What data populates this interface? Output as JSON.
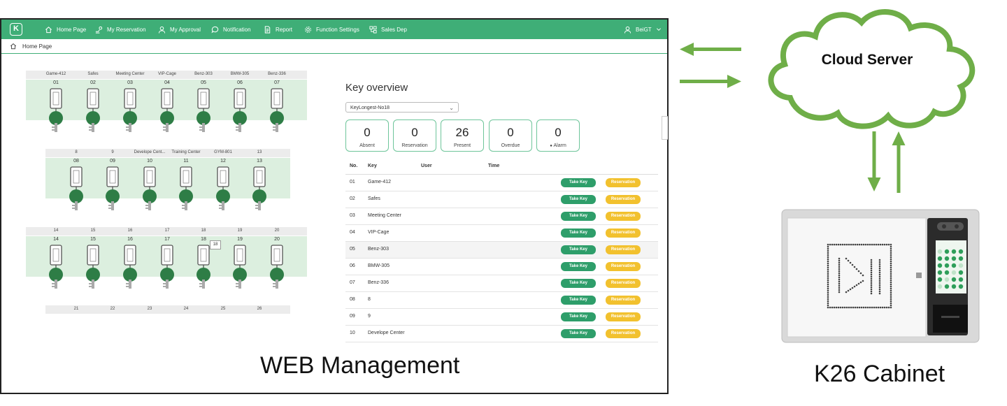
{
  "nav": {
    "items": [
      {
        "label": "Home Page",
        "icon": "home-icon"
      },
      {
        "label": "My Reservation",
        "icon": "key-hand-icon"
      },
      {
        "label": "My Approval",
        "icon": "user-icon"
      },
      {
        "label": "Notification",
        "icon": "chat-icon"
      },
      {
        "label": "Report",
        "icon": "document-icon"
      },
      {
        "label": "Function Settings",
        "icon": "gear-icon"
      },
      {
        "label": "Sales Dep",
        "icon": "org-icon"
      }
    ],
    "user": "BeiGT"
  },
  "breadcrumb": "Home Page",
  "cabinet": {
    "rows": [
      {
        "labels": [
          "Game-412",
          "Safes",
          "Meeting Center",
          "VIP-Cage",
          "Benz-303",
          "BMW-305",
          "Benz-336"
        ],
        "numbers": [
          "01",
          "02",
          "03",
          "04",
          "05",
          "06",
          "07"
        ]
      },
      {
        "labels": [
          "8",
          "9",
          "Develope Cent...",
          "Training Center",
          "GYM-801",
          "13"
        ],
        "numbers": [
          "08",
          "09",
          "10",
          "11",
          "12",
          "13"
        ]
      },
      {
        "labels": [
          "14",
          "15",
          "16",
          "17",
          "18",
          "19",
          "20"
        ],
        "numbers": [
          "14",
          "15",
          "16",
          "17",
          "18",
          "19",
          "20"
        ]
      },
      {
        "labels": [
          "21",
          "22",
          "23",
          "24",
          "25",
          "26"
        ],
        "numbers": []
      }
    ],
    "tooltip": "18"
  },
  "overview": {
    "title": "Key overview",
    "cabinet_select": "KeyLongest-No18",
    "stats": [
      {
        "value": "0",
        "label": "Absent"
      },
      {
        "value": "0",
        "label": "Reservation"
      },
      {
        "value": "26",
        "label": "Present"
      },
      {
        "value": "0",
        "label": "Overdue"
      },
      {
        "value": "0",
        "label": "Alarm"
      }
    ],
    "columns": [
      "No.",
      "Key",
      "User",
      "Time"
    ],
    "rows": [
      {
        "no": "01",
        "key": "Game-412"
      },
      {
        "no": "02",
        "key": "Safes"
      },
      {
        "no": "03",
        "key": "Meeting Center"
      },
      {
        "no": "04",
        "key": "VIP-Cage"
      },
      {
        "no": "05",
        "key": "Benz-303"
      },
      {
        "no": "06",
        "key": "BMW-305"
      },
      {
        "no": "07",
        "key": "Benz-336"
      },
      {
        "no": "08",
        "key": "8"
      },
      {
        "no": "09",
        "key": "9"
      },
      {
        "no": "10",
        "key": "Develope Center"
      }
    ],
    "take_label": "Take Key",
    "reserve_label": "Reservation"
  },
  "diagram": {
    "web_caption": "WEB Management",
    "cloud_label": "Cloud Server",
    "cabinet_caption": "K26 Cabinet",
    "arrow_color": "#6fae48",
    "brand_green": "#3fae77"
  }
}
